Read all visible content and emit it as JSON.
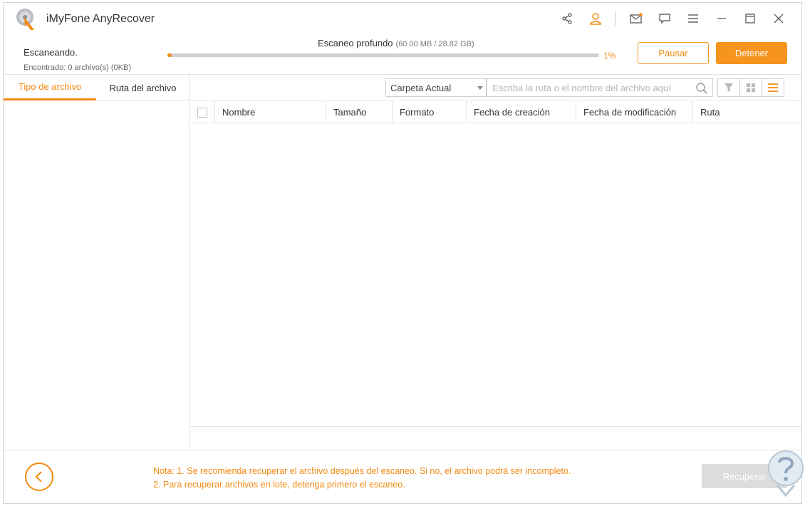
{
  "window": {
    "title": "iMyFone AnyRecover"
  },
  "titlebar_icons": [
    "share-icon",
    "user-icon",
    "mail-icon",
    "feedback-icon",
    "menu-icon",
    "minimize-icon",
    "maximize-icon",
    "close-icon"
  ],
  "scan": {
    "status": "Escaneando.",
    "found": "Encontrado: 0 archivo(s) (0KB)",
    "title": "Escaneo profundo",
    "size_info": "(60.00 MB / 28.82 GB)",
    "progress_percent": 1,
    "progress_label": "1%",
    "pause_label": "Pausar",
    "stop_label": "Detener"
  },
  "left_tabs": [
    {
      "label": "Tipo de archivo",
      "active": true
    },
    {
      "label": "Ruta del archivo",
      "active": false
    }
  ],
  "toolbar": {
    "folder_select": "Carpeta Actual",
    "search_placeholder": "Escriba la ruta o el nombre del archivo aquí"
  },
  "table": {
    "columns": [
      "Nombre",
      "Tamaño",
      "Formato",
      "Fecha de creación",
      "Fecha de modificación",
      "Ruta"
    ]
  },
  "footer": {
    "note_line1": "Nota: 1. Se recomienda recuperar el archivo después del escaneo. Si no, el archivo podrá ser incompleto.",
    "note_line2": "2. Para recuperar archivos en lote, detenga primero el escaneo.",
    "recover_label": "Recuperar"
  },
  "colors": {
    "accent": "#f28a12",
    "stop_button": "#f7941d",
    "recover_disabled": "#dcdcdc"
  }
}
